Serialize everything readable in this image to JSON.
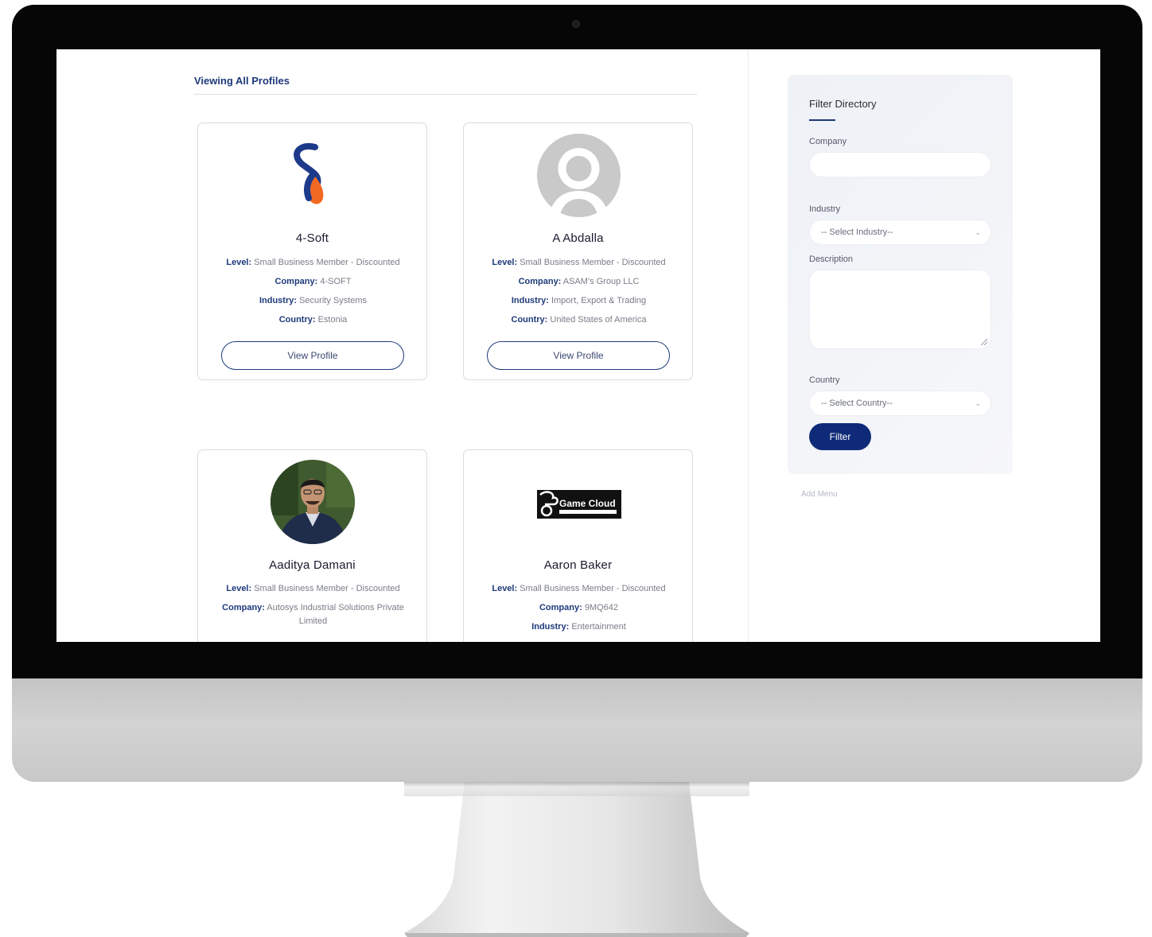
{
  "page": {
    "title": "Viewing All Profiles"
  },
  "labels": {
    "level": "Level:",
    "company": "Company:",
    "industry": "Industry:",
    "country": "Country:",
    "view_profile": "View Profile"
  },
  "profiles": [
    {
      "name": "4-Soft",
      "level": "Small Business Member - Discounted",
      "company": "4-SOFT",
      "industry": "Security Systems",
      "country": "Estonia",
      "avatar": "4soft-logo-icon"
    },
    {
      "name": "A Abdalla",
      "level": "Small Business Member - Discounted",
      "company": "ASAM's Group LLC",
      "industry": "Import, Export & Trading",
      "country": "United States of America",
      "avatar": "default-user-icon"
    },
    {
      "name": "Aaditya Damani",
      "level": "Small Business Member - Discounted",
      "company": "Autosys Industrial Solutions Private Limited",
      "avatar": "user-photo"
    },
    {
      "name": "Aaron Baker",
      "level": "Small Business Member - Discounted",
      "company": "9MQ642",
      "industry": "Entertainment",
      "avatar": "game-cloud-logo",
      "logo_text": "Game Cloud"
    }
  ],
  "filter": {
    "title": "Filter Directory",
    "company_label": "Company",
    "company_value": "",
    "industry_label": "Industry",
    "industry_selected": "-- Select Industry--",
    "description_label": "Description",
    "description_value": "",
    "country_label": "Country",
    "country_selected": "-- Select Country--",
    "button": "Filter"
  },
  "add_menu": "Add Menu",
  "colors": {
    "accent": "#1e3a7a",
    "button": "#0f2a78",
    "logo_blue": "#1d3a8a",
    "logo_orange": "#f26a21"
  }
}
